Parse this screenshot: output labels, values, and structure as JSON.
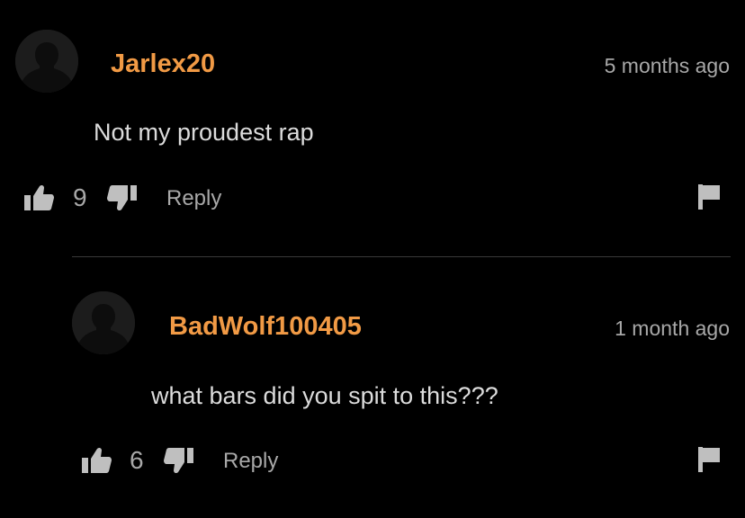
{
  "comments": [
    {
      "username": "Jarlex20",
      "timestamp": "5 months ago",
      "text": "Not my proudest rap",
      "likes": "9",
      "reply_label": "Reply"
    },
    {
      "username": "BadWolf100405",
      "timestamp": "1 month ago",
      "text": "what bars did you spit to this???",
      "likes": "6",
      "reply_label": "Reply"
    }
  ],
  "colors": {
    "background": "#000000",
    "username": "#f19a45",
    "text": "#dcdcdc",
    "muted": "#a8a8a8",
    "icon": "#bfbfbf",
    "avatar_bg": "#1c1c1c",
    "avatar_silhouette": "#0d0d0d",
    "divider": "#3a3a3a"
  },
  "icons": {
    "avatar": "default-user-avatar-icon",
    "like": "thumbs-up-icon",
    "dislike": "thumbs-down-icon",
    "report": "flag-icon"
  }
}
